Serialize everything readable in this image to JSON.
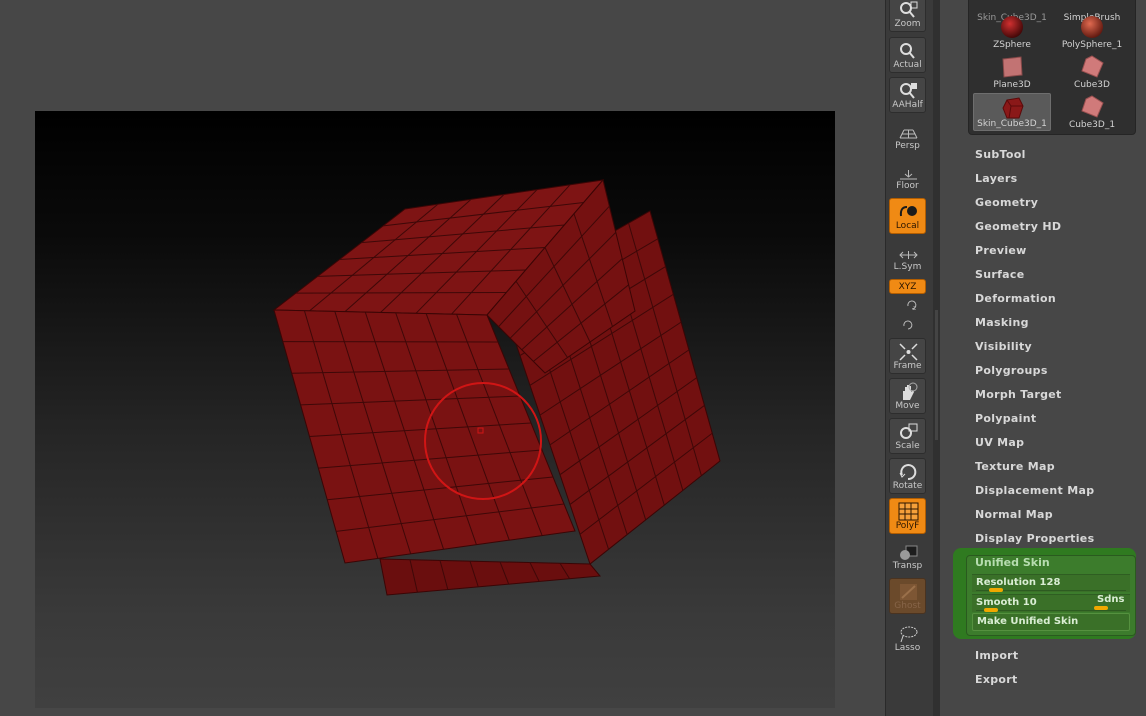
{
  "shelf": {
    "zoom": "Zoom",
    "actual": "Actual",
    "aahalf": "AAHalf",
    "persp": "Persp",
    "floor": "Floor",
    "local": "Local",
    "lsym": "L.Sym",
    "xyz": "XYZ",
    "frame": "Frame",
    "move": "Move",
    "scale": "Scale",
    "rotate": "Rotate",
    "polyf": "PolyF",
    "transp": "Transp",
    "ghost": "Ghost",
    "lasso": "Lasso"
  },
  "tools": [
    {
      "label": "Skin_Cube3D_1"
    },
    {
      "label": "SimpleBrush"
    },
    {
      "label": "ZSphere"
    },
    {
      "label": "PolySphere_1"
    },
    {
      "label": "Plane3D"
    },
    {
      "label": "Cube3D"
    },
    {
      "label": "Skin_Cube3D_1"
    },
    {
      "label": "Cube3D_1"
    }
  ],
  "menu": {
    "subtool": "SubTool",
    "layers": "Layers",
    "geometry": "Geometry",
    "geometry_hd": "Geometry HD",
    "preview": "Preview",
    "surface": "Surface",
    "deformation": "Deformation",
    "masking": "Masking",
    "visibility": "Visibility",
    "polygroups": "Polygroups",
    "morph_target": "Morph Target",
    "polypaint": "Polypaint",
    "uv_map": "UV Map",
    "texture_map": "Texture Map",
    "displacement_map": "Displacement Map",
    "normal_map": "Normal Map",
    "display_properties": "Display Properties",
    "import": "Import",
    "export": "Export"
  },
  "unified_skin": {
    "title": "Unified Skin",
    "resolution_label": "Resolution 128",
    "resolution_value": 128,
    "smooth_label": "Smooth 10",
    "smooth_value": 10,
    "sdns_label": "Sdns",
    "make_button": "Make Unified Skin"
  },
  "colors": {
    "mesh": "#7a1111",
    "accent": "#f08a14",
    "panel_green": "#2f7a20",
    "brush_ring": "#d01515"
  }
}
